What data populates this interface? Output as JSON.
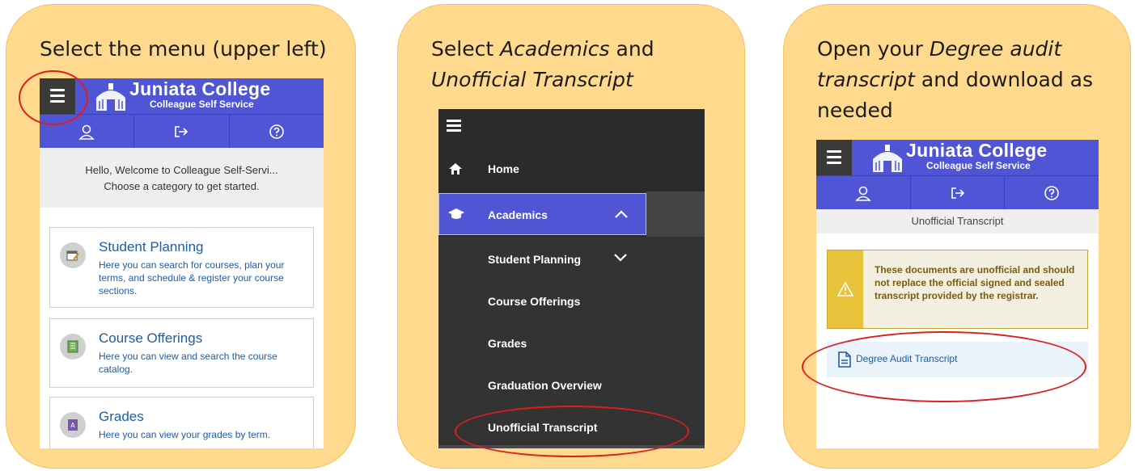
{
  "panels": {
    "p1": {
      "caption": "Select the menu (upper left)",
      "brand": "Juniata College",
      "brand_sub": "Colleague Self Service",
      "welcome_line1": "Hello, Welcome to Colleague Self-Servi...",
      "welcome_line2": "Choose a category to get started.",
      "cards": [
        {
          "title": "Student Planning",
          "desc": "Here you can search for courses, plan your terms, and schedule & register your course sections."
        },
        {
          "title": "Course Offerings",
          "desc": "Here you can view and search the course catalog."
        },
        {
          "title": "Grades",
          "desc": "Here you can view your grades by term."
        }
      ]
    },
    "p2": {
      "caption_pre": "Select ",
      "caption_em1": "Academics",
      "caption_mid": " and",
      "caption_em2": "Unofficial Transcript",
      "menu": {
        "home": "Home",
        "academics": "Academics",
        "sub": [
          "Student Planning",
          "Course Offerings",
          "Grades",
          "Graduation Overview",
          "Unofficial Transcript"
        ]
      }
    },
    "p3": {
      "caption_pre": "Open your ",
      "caption_em1": "Degree audit",
      "caption_em2": "transcript",
      "caption_post": " and download as",
      "caption_line3": "needed",
      "brand": "Juniata College",
      "brand_sub": "Colleague Self Service",
      "subtitle": "Unofficial Transcript",
      "warning": "These documents are unofficial and should not replace the official signed and sealed transcript provided by the registrar.",
      "doc_link": "Degree Audit Transcript"
    }
  },
  "colors": {
    "panel_bg": "#ffd98e",
    "header_blue": "#4f55d4",
    "menu_dark": "#333333",
    "link_blue": "#1d5ea8",
    "highlight_ring": "#e01d1d"
  }
}
